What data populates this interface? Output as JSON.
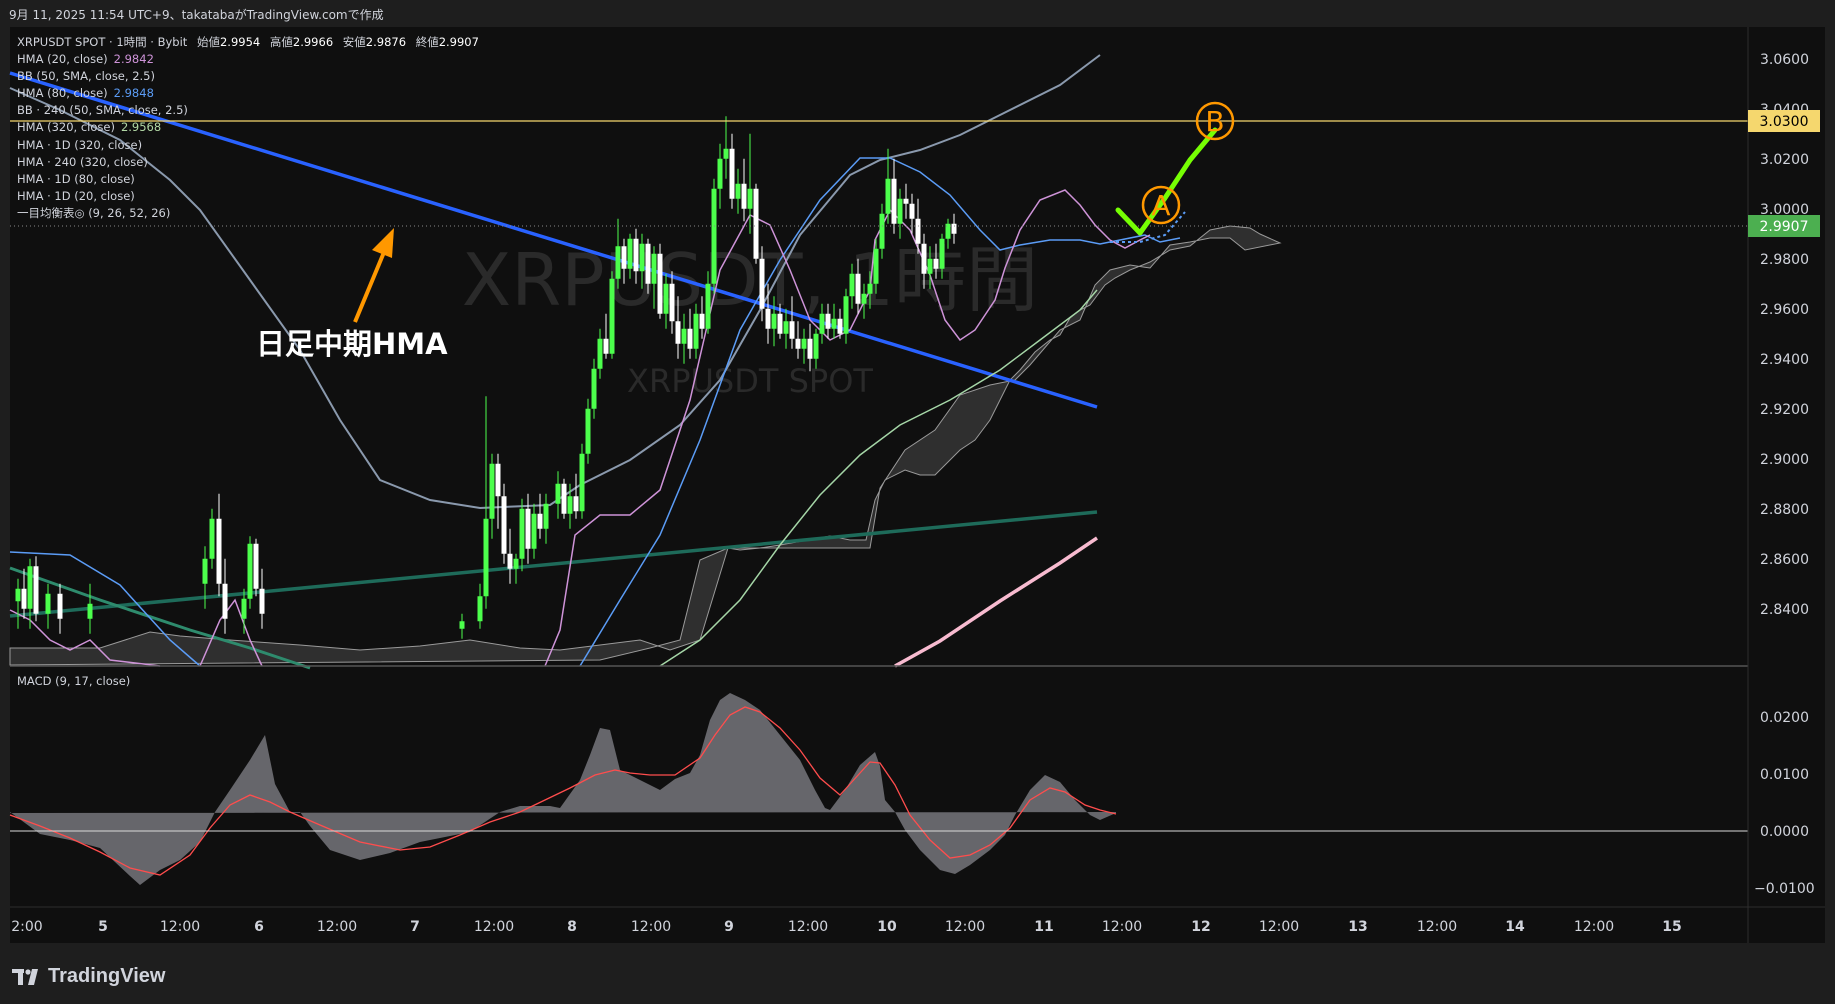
{
  "header": {
    "caption": "9月 11, 2025 11:54 UTC+9、takatabaがTradingView.comで作成"
  },
  "legend": {
    "symbol_line": {
      "symbol": "XRPUSDT SPOT · 1時間 · Bybit",
      "open_label": "始値",
      "open": "2.9954",
      "high_label": "高値",
      "high": "2.9966",
      "low_label": "安値",
      "low": "2.9876",
      "close_label": "終値",
      "close": "2.9907"
    },
    "indicators": [
      {
        "label": "HMA (20, close)",
        "value": "2.9842",
        "color": "#ce93d8"
      },
      {
        "label": "BB (50, SMA, close, 2.5)",
        "value": "",
        "color": "#d1d4dc"
      },
      {
        "label": "HMA (80, close)",
        "value": "2.9848",
        "color": "#5b9cf6"
      },
      {
        "label": "BB · 240 (50, SMA, close, 2.5)",
        "value": "",
        "color": "#d1d4dc"
      },
      {
        "label": "HMA (320, close)",
        "value": "2.9568",
        "color": "#b2d8a5"
      },
      {
        "label": "HMA · 1D (320, close)",
        "value": "",
        "color": "#d1d4dc"
      },
      {
        "label": "HMA · 240 (320, close)",
        "value": "",
        "color": "#d1d4dc"
      },
      {
        "label": "HMA · 1D (80, close)",
        "value": "",
        "color": "#d1d4dc"
      },
      {
        "label": "HMA · 1D (20, close)",
        "value": "",
        "color": "#d1d4dc"
      },
      {
        "label": "一目均衡表◎ (9, 26, 52, 26)",
        "value": "",
        "color": "#d1d4dc"
      }
    ]
  },
  "watermark": {
    "title": "XRPUSDT, 1時間",
    "subtitle": "XRPUSDT SPOT"
  },
  "annotations": {
    "arrow_label": "日足中期HMA",
    "marker_a": "A",
    "marker_b": "B"
  },
  "macd_legend": "MACD (9, 17, close)",
  "price_badges": {
    "resistance": "3.0300",
    "last": "2.9907"
  },
  "colors": {
    "up": "#4cff4c",
    "down": "#ffffff",
    "hma_daily_mid": "#2962ff",
    "hma_240": "#1e6b5a",
    "hma_daily_long": "#f8bbd0",
    "hma20": "#ce93d8",
    "hma80": "#5b9cf6",
    "hma320": "#a5d6a7",
    "bb": "#8a99ad",
    "resistance_line": "#f5d76e",
    "macd_fill": "#707076",
    "signal": "#ff4d4d",
    "arrow": "#ff9800",
    "path": "#76ff03"
  },
  "footer": {
    "brand": "TradingView"
  },
  "chart_data": {
    "type": "candlestick",
    "title": "XRPUSDT SPOT · 1時間 · Bybit",
    "ylim": [
      2.8275,
      3.0675
    ],
    "y_ticks": [
      "3.0600",
      "3.0400",
      "3.0200",
      "3.0000",
      "2.9800",
      "2.9600",
      "2.9400",
      "2.9200",
      "2.9000",
      "2.8800",
      "2.8600",
      "2.8400"
    ],
    "x_ticks": [
      "2:00",
      "5",
      "12:00",
      "6",
      "12:00",
      "7",
      "12:00",
      "8",
      "12:00",
      "9",
      "12:00",
      "10",
      "12:00",
      "11",
      "12:00",
      "12",
      "12:00",
      "13",
      "12:00",
      "14",
      "12:00",
      "15"
    ],
    "resistance_level": 3.03,
    "last_price": 2.9907,
    "candles": [
      {
        "x": 18,
        "o": 2.843,
        "h": 2.852,
        "l": 2.832,
        "c": 2.848
      },
      {
        "x": 24,
        "o": 2.848,
        "h": 2.856,
        "l": 2.836,
        "c": 2.84
      },
      {
        "x": 30,
        "o": 2.84,
        "h": 2.86,
        "l": 2.832,
        "c": 2.857
      },
      {
        "x": 36,
        "o": 2.857,
        "h": 2.861,
        "l": 2.835,
        "c": 2.838
      },
      {
        "x": 48,
        "o": 2.838,
        "h": 2.85,
        "l": 2.832,
        "c": 2.846
      },
      {
        "x": 60,
        "o": 2.846,
        "h": 2.85,
        "l": 2.83,
        "c": 2.836
      },
      {
        "x": 90,
        "o": 2.836,
        "h": 2.85,
        "l": 2.83,
        "c": 2.842
      },
      {
        "x": 205,
        "o": 2.85,
        "h": 2.865,
        "l": 2.84,
        "c": 2.86
      },
      {
        "x": 212,
        "o": 2.86,
        "h": 2.88,
        "l": 2.856,
        "c": 2.876
      },
      {
        "x": 219,
        "o": 2.876,
        "h": 2.886,
        "l": 2.845,
        "c": 2.85
      },
      {
        "x": 225,
        "o": 2.85,
        "h": 2.86,
        "l": 2.83,
        "c": 2.836
      },
      {
        "x": 244,
        "o": 2.836,
        "h": 2.848,
        "l": 2.83,
        "c": 2.844
      },
      {
        "x": 250,
        "o": 2.844,
        "h": 2.869,
        "l": 2.84,
        "c": 2.866
      },
      {
        "x": 256,
        "o": 2.866,
        "h": 2.868,
        "l": 2.845,
        "c": 2.848
      },
      {
        "x": 262,
        "o": 2.848,
        "h": 2.856,
        "l": 2.832,
        "c": 2.838
      },
      {
        "x": 462,
        "o": 2.832,
        "h": 2.838,
        "l": 2.828,
        "c": 2.835
      },
      {
        "x": 480,
        "o": 2.835,
        "h": 2.85,
        "l": 2.832,
        "c": 2.845
      },
      {
        "x": 486,
        "o": 2.845,
        "h": 2.925,
        "l": 2.84,
        "c": 2.876
      },
      {
        "x": 492,
        "o": 2.876,
        "h": 2.902,
        "l": 2.868,
        "c": 2.898
      },
      {
        "x": 498,
        "o": 2.898,
        "h": 2.902,
        "l": 2.872,
        "c": 2.885
      },
      {
        "x": 504,
        "o": 2.885,
        "h": 2.89,
        "l": 2.858,
        "c": 2.862
      },
      {
        "x": 510,
        "o": 2.862,
        "h": 2.872,
        "l": 2.85,
        "c": 2.856
      },
      {
        "x": 516,
        "o": 2.856,
        "h": 2.862,
        "l": 2.85,
        "c": 2.86
      },
      {
        "x": 522,
        "o": 2.86,
        "h": 2.884,
        "l": 2.855,
        "c": 2.88
      },
      {
        "x": 528,
        "o": 2.88,
        "h": 2.886,
        "l": 2.858,
        "c": 2.864
      },
      {
        "x": 534,
        "o": 2.864,
        "h": 2.882,
        "l": 2.86,
        "c": 2.878
      },
      {
        "x": 540,
        "o": 2.878,
        "h": 2.886,
        "l": 2.868,
        "c": 2.872
      },
      {
        "x": 546,
        "o": 2.872,
        "h": 2.886,
        "l": 2.866,
        "c": 2.882
      },
      {
        "x": 558,
        "o": 2.882,
        "h": 2.895,
        "l": 2.876,
        "c": 2.89
      },
      {
        "x": 564,
        "o": 2.89,
        "h": 2.892,
        "l": 2.876,
        "c": 2.878
      },
      {
        "x": 570,
        "o": 2.878,
        "h": 2.89,
        "l": 2.872,
        "c": 2.885
      },
      {
        "x": 576,
        "o": 2.885,
        "h": 2.894,
        "l": 2.876,
        "c": 2.879
      },
      {
        "x": 582,
        "o": 2.879,
        "h": 2.906,
        "l": 2.876,
        "c": 2.902
      },
      {
        "x": 588,
        "o": 2.902,
        "h": 2.924,
        "l": 2.898,
        "c": 2.92
      },
      {
        "x": 594,
        "o": 2.92,
        "h": 2.94,
        "l": 2.916,
        "c": 2.936
      },
      {
        "x": 600,
        "o": 2.936,
        "h": 2.952,
        "l": 2.932,
        "c": 2.948
      },
      {
        "x": 606,
        "o": 2.948,
        "h": 2.958,
        "l": 2.94,
        "c": 2.942
      },
      {
        "x": 612,
        "o": 2.942,
        "h": 2.975,
        "l": 2.94,
        "c": 2.972
      },
      {
        "x": 618,
        "o": 2.972,
        "h": 2.996,
        "l": 2.968,
        "c": 2.985
      },
      {
        "x": 624,
        "o": 2.985,
        "h": 2.988,
        "l": 2.97,
        "c": 2.976
      },
      {
        "x": 630,
        "o": 2.976,
        "h": 2.99,
        "l": 2.972,
        "c": 2.988
      },
      {
        "x": 636,
        "o": 2.988,
        "h": 2.992,
        "l": 2.97,
        "c": 2.975
      },
      {
        "x": 642,
        "o": 2.975,
        "h": 2.99,
        "l": 2.968,
        "c": 2.986
      },
      {
        "x": 648,
        "o": 2.986,
        "h": 2.988,
        "l": 2.966,
        "c": 2.97
      },
      {
        "x": 654,
        "o": 2.97,
        "h": 2.985,
        "l": 2.96,
        "c": 2.982
      },
      {
        "x": 660,
        "o": 2.982,
        "h": 2.986,
        "l": 2.956,
        "c": 2.958
      },
      {
        "x": 666,
        "o": 2.958,
        "h": 2.974,
        "l": 2.952,
        "c": 2.97
      },
      {
        "x": 672,
        "o": 2.97,
        "h": 2.975,
        "l": 2.95,
        "c": 2.955
      },
      {
        "x": 678,
        "o": 2.955,
        "h": 2.965,
        "l": 2.94,
        "c": 2.946
      },
      {
        "x": 684,
        "o": 2.946,
        "h": 2.958,
        "l": 2.938,
        "c": 2.952
      },
      {
        "x": 690,
        "o": 2.952,
        "h": 2.96,
        "l": 2.94,
        "c": 2.944
      },
      {
        "x": 696,
        "o": 2.944,
        "h": 2.962,
        "l": 2.94,
        "c": 2.958
      },
      {
        "x": 702,
        "o": 2.958,
        "h": 2.965,
        "l": 2.948,
        "c": 2.952
      },
      {
        "x": 708,
        "o": 2.952,
        "h": 2.975,
        "l": 2.95,
        "c": 2.97
      },
      {
        "x": 714,
        "o": 2.97,
        "h": 3.012,
        "l": 2.966,
        "c": 3.008
      },
      {
        "x": 720,
        "o": 3.008,
        "h": 3.026,
        "l": 3.0,
        "c": 3.02
      },
      {
        "x": 726,
        "o": 3.02,
        "h": 3.037,
        "l": 3.012,
        "c": 3.024
      },
      {
        "x": 732,
        "o": 3.024,
        "h": 3.03,
        "l": 3.0,
        "c": 3.004
      },
      {
        "x": 738,
        "o": 3.004,
        "h": 3.016,
        "l": 2.998,
        "c": 3.01
      },
      {
        "x": 744,
        "o": 3.01,
        "h": 3.02,
        "l": 2.995,
        "c": 3.0
      },
      {
        "x": 750,
        "o": 3.0,
        "h": 3.03,
        "l": 2.99,
        "c": 3.008
      },
      {
        "x": 756,
        "o": 3.008,
        "h": 3.01,
        "l": 2.978,
        "c": 2.98
      },
      {
        "x": 762,
        "o": 2.98,
        "h": 2.985,
        "l": 2.955,
        "c": 2.96
      },
      {
        "x": 768,
        "o": 2.96,
        "h": 2.97,
        "l": 2.946,
        "c": 2.952
      },
      {
        "x": 774,
        "o": 2.952,
        "h": 2.965,
        "l": 2.945,
        "c": 2.958
      },
      {
        "x": 780,
        "o": 2.958,
        "h": 2.962,
        "l": 2.948,
        "c": 2.95
      },
      {
        "x": 786,
        "o": 2.95,
        "h": 2.96,
        "l": 2.944,
        "c": 2.955
      },
      {
        "x": 792,
        "o": 2.955,
        "h": 2.965,
        "l": 2.944,
        "c": 2.948
      },
      {
        "x": 798,
        "o": 2.948,
        "h": 2.955,
        "l": 2.94,
        "c": 2.944
      },
      {
        "x": 804,
        "o": 2.944,
        "h": 2.952,
        "l": 2.938,
        "c": 2.948
      },
      {
        "x": 810,
        "o": 2.948,
        "h": 2.954,
        "l": 2.935,
        "c": 2.94
      },
      {
        "x": 816,
        "o": 2.94,
        "h": 2.952,
        "l": 2.936,
        "c": 2.95
      },
      {
        "x": 822,
        "o": 2.95,
        "h": 2.962,
        "l": 2.946,
        "c": 2.958
      },
      {
        "x": 828,
        "o": 2.958,
        "h": 2.962,
        "l": 2.948,
        "c": 2.952
      },
      {
        "x": 834,
        "o": 2.952,
        "h": 2.962,
        "l": 2.948,
        "c": 2.956
      },
      {
        "x": 840,
        "o": 2.956,
        "h": 2.96,
        "l": 2.948,
        "c": 2.95
      },
      {
        "x": 846,
        "o": 2.95,
        "h": 2.968,
        "l": 2.946,
        "c": 2.965
      },
      {
        "x": 852,
        "o": 2.965,
        "h": 2.978,
        "l": 2.96,
        "c": 2.974
      },
      {
        "x": 858,
        "o": 2.974,
        "h": 2.98,
        "l": 2.958,
        "c": 2.962
      },
      {
        "x": 864,
        "o": 2.962,
        "h": 2.97,
        "l": 2.956,
        "c": 2.966
      },
      {
        "x": 870,
        "o": 2.966,
        "h": 2.975,
        "l": 2.96,
        "c": 2.97
      },
      {
        "x": 876,
        "o": 2.97,
        "h": 2.988,
        "l": 2.966,
        "c": 2.984
      },
      {
        "x": 882,
        "o": 2.984,
        "h": 3.002,
        "l": 2.98,
        "c": 2.998
      },
      {
        "x": 888,
        "o": 2.998,
        "h": 3.024,
        "l": 2.994,
        "c": 3.012
      },
      {
        "x": 894,
        "o": 3.012,
        "h": 3.02,
        "l": 2.99,
        "c": 2.994
      },
      {
        "x": 900,
        "o": 2.994,
        "h": 3.008,
        "l": 2.988,
        "c": 3.004
      },
      {
        "x": 906,
        "o": 3.004,
        "h": 3.01,
        "l": 2.996,
        "c": 3.002
      },
      {
        "x": 912,
        "o": 3.002,
        "h": 3.006,
        "l": 2.99,
        "c": 2.996
      },
      {
        "x": 918,
        "o": 2.996,
        "h": 3.004,
        "l": 2.982,
        "c": 2.986
      },
      {
        "x": 924,
        "o": 2.986,
        "h": 2.99,
        "l": 2.968,
        "c": 2.974
      },
      {
        "x": 930,
        "o": 2.974,
        "h": 2.985,
        "l": 2.968,
        "c": 2.98
      },
      {
        "x": 936,
        "o": 2.98,
        "h": 2.986,
        "l": 2.972,
        "c": 2.976
      },
      {
        "x": 942,
        "o": 2.976,
        "h": 2.99,
        "l": 2.972,
        "c": 2.988
      },
      {
        "x": 948,
        "o": 2.988,
        "h": 2.996,
        "l": 2.984,
        "c": 2.994
      },
      {
        "x": 954,
        "o": 2.994,
        "h": 2.998,
        "l": 2.986,
        "c": 2.99
      }
    ]
  }
}
